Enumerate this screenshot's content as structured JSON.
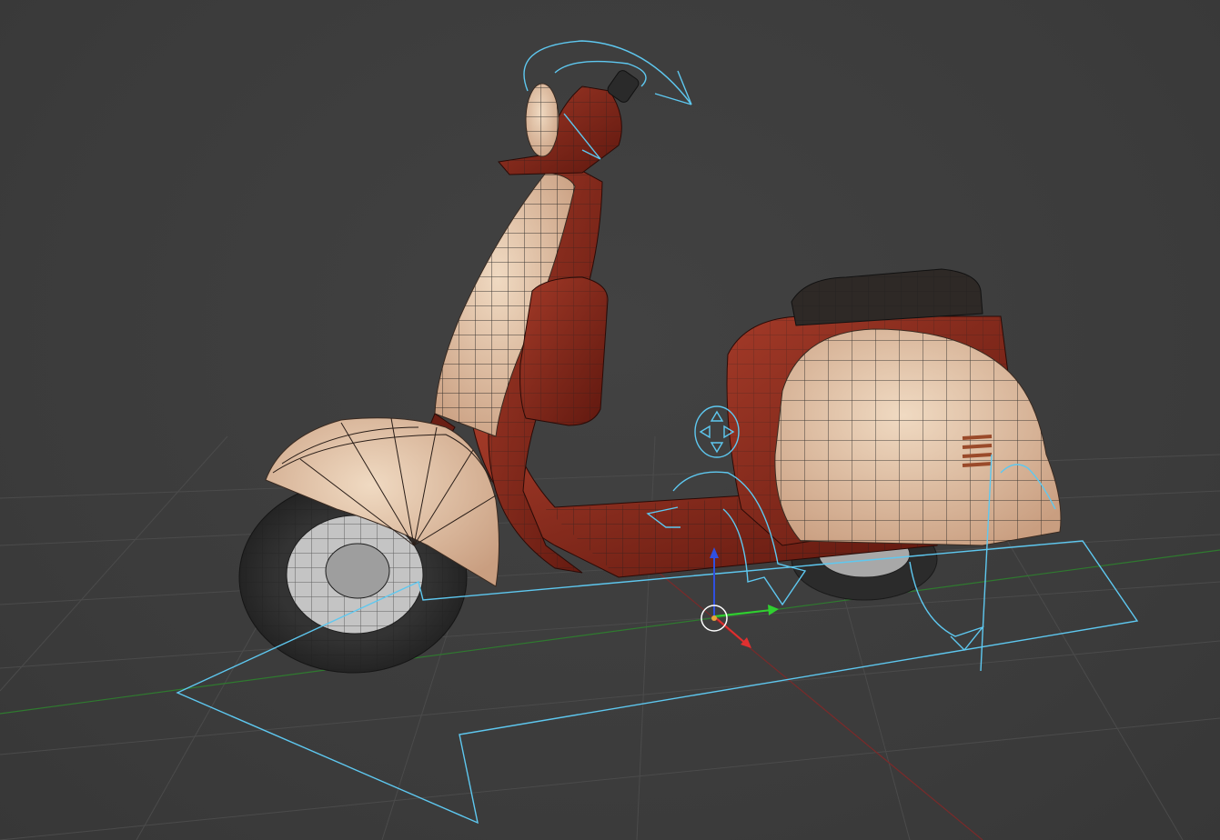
{
  "viewport": {
    "background": "#3d3d3d",
    "grid_color": "#4a4a4a",
    "axis_x_color": "#7a2a2a",
    "axis_y_color": "#2f7a2f",
    "rig_color": "#5ec8f0"
  },
  "model": {
    "body_red": "#8a2a1e",
    "body_red_dark": "#5a150e",
    "panel_cream": "#e6c9ac",
    "seat_color": "#2e2926",
    "tire_color": "#2d2d2d",
    "rim_color": "#bdbdbd",
    "wire_color": "#1e1e1e"
  },
  "gizmo": {
    "x_axis_color": "#e03030",
    "y_axis_color": "#30d030",
    "z_axis_color": "#3050e0",
    "pivot_color": "#e8a33a"
  }
}
